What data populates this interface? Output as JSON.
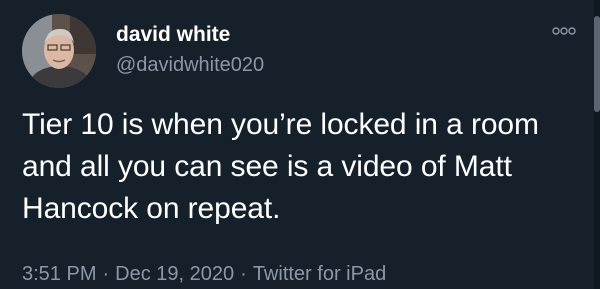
{
  "author": {
    "display_name": "david white",
    "handle": "@davidwhite020",
    "avatar_icon": "profile-photo"
  },
  "more_icon": "ellipsis-icon",
  "tweet": {
    "text": "Tier 10 is when you’re locked in a room and all you can see is a video of Matt Hancock on repeat."
  },
  "meta": {
    "time": "3:51 PM",
    "date": "Dec 19, 2020",
    "separator": "·",
    "source": "Twitter for iPad"
  },
  "colors": {
    "background": "#15202b",
    "primary_text": "#ffffff",
    "secondary_text": "#8b98a5"
  }
}
